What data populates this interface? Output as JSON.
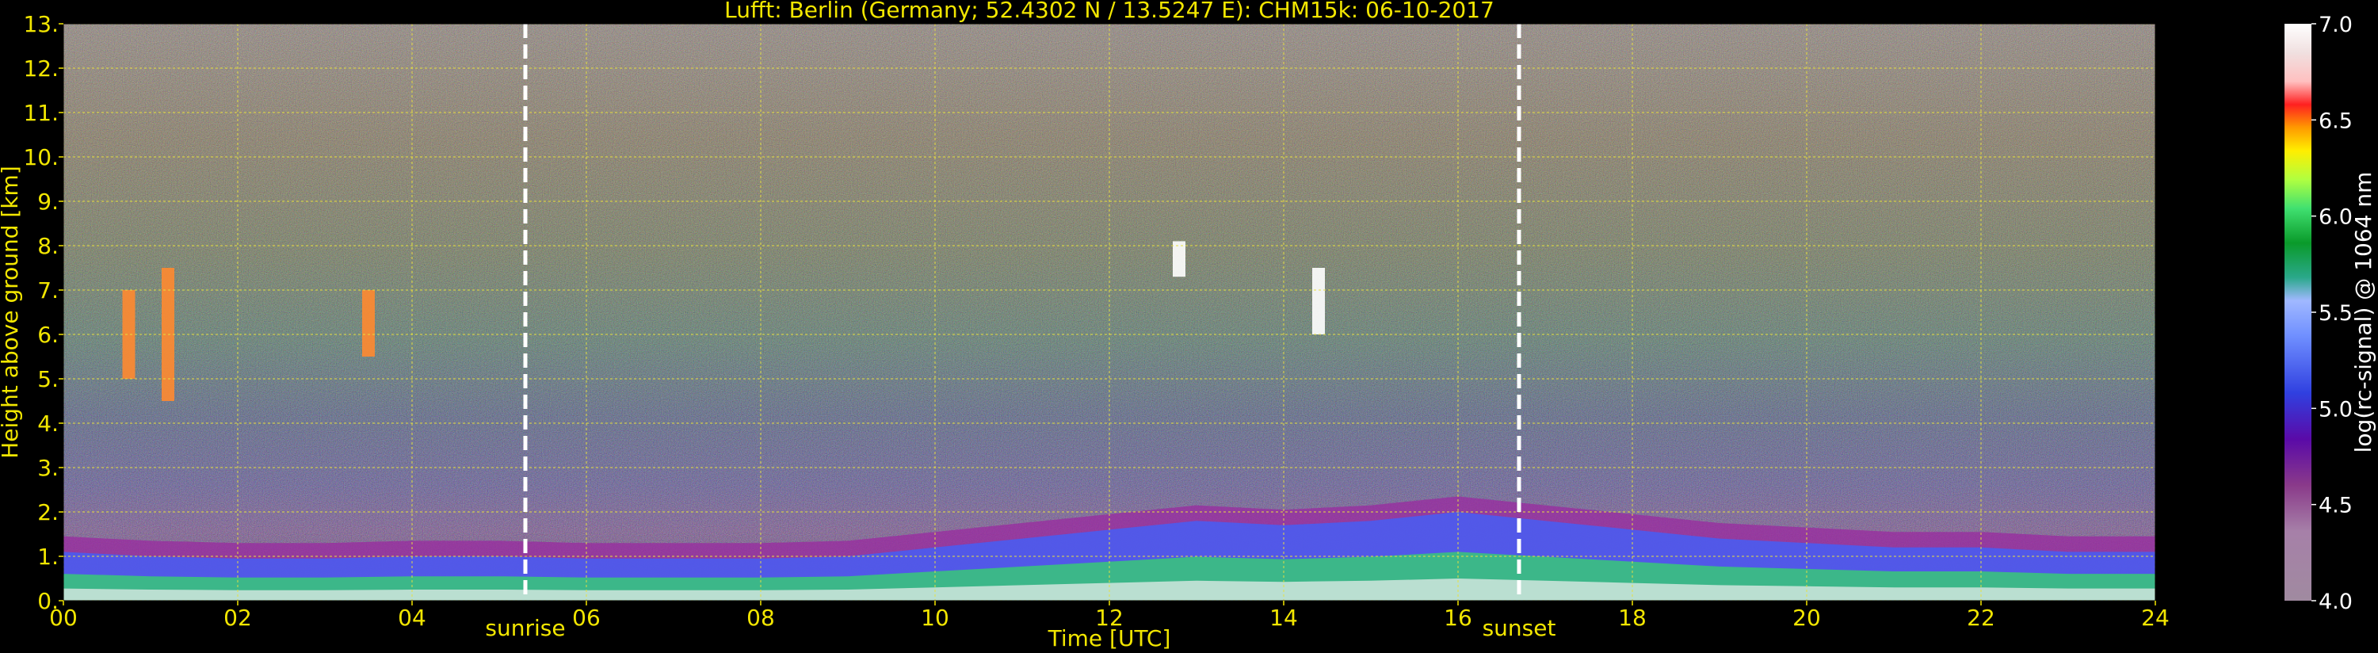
{
  "chart_data": {
    "type": "heatmap",
    "title": "Lufft: Berlin (Germany; 52.4302 N / 13.5247 E):     CHM15k: 06-10-2017",
    "xlabel": "Time [UTC]",
    "ylabel": "Height above ground [km]",
    "x_ticks": [
      "00",
      "02",
      "04",
      "06",
      "08",
      "10",
      "12",
      "14",
      "16",
      "18",
      "20",
      "22",
      "24"
    ],
    "y_ticks": [
      "0.",
      "1.",
      "2.",
      "3.",
      "4.",
      "5.",
      "6.",
      "7.",
      "8.",
      "9.",
      "10.",
      "11.",
      "12.",
      "13."
    ],
    "xlim": [
      0,
      24
    ],
    "ylim": [
      0,
      13
    ],
    "grid": true,
    "colorbar": {
      "label": "log(rc-signal) @ 1064 nm",
      "ticks": [
        "4.0",
        "4.5",
        "5.0",
        "5.5",
        "6.0",
        "6.5",
        "7.0"
      ],
      "range": [
        4.0,
        7.0
      ]
    },
    "annotations": [
      {
        "text": "sunrise",
        "x": 5.3
      },
      {
        "text": "sunset",
        "x": 16.7
      }
    ],
    "boundary_layer_top_km": [
      [
        0,
        1.1
      ],
      [
        1,
        1.0
      ],
      [
        2,
        0.95
      ],
      [
        3,
        0.95
      ],
      [
        4,
        1.0
      ],
      [
        5,
        1.0
      ],
      [
        6,
        0.95
      ],
      [
        7,
        0.95
      ],
      [
        8,
        0.95
      ],
      [
        9,
        1.0
      ],
      [
        10,
        1.2
      ],
      [
        11,
        1.4
      ],
      [
        12,
        1.6
      ],
      [
        13,
        1.8
      ],
      [
        14,
        1.7
      ],
      [
        15,
        1.8
      ],
      [
        16,
        2.0
      ],
      [
        17,
        1.8
      ],
      [
        18,
        1.6
      ],
      [
        19,
        1.4
      ],
      [
        20,
        1.3
      ],
      [
        21,
        1.2
      ],
      [
        22,
        1.2
      ],
      [
        23,
        1.1
      ],
      [
        24,
        1.1
      ]
    ],
    "cloud_features": [
      {
        "x": 0.75,
        "y_top": 7.0,
        "y_bottom": 5.0
      },
      {
        "x": 1.2,
        "y_top": 7.5,
        "y_bottom": 4.5
      },
      {
        "x": 3.5,
        "y_top": 7.0,
        "y_bottom": 5.5
      },
      {
        "x": 12.8,
        "y_top": 8.1,
        "y_bottom": 7.3
      },
      {
        "x": 14.4,
        "y_top": 7.5,
        "y_bottom": 6.0
      }
    ]
  }
}
